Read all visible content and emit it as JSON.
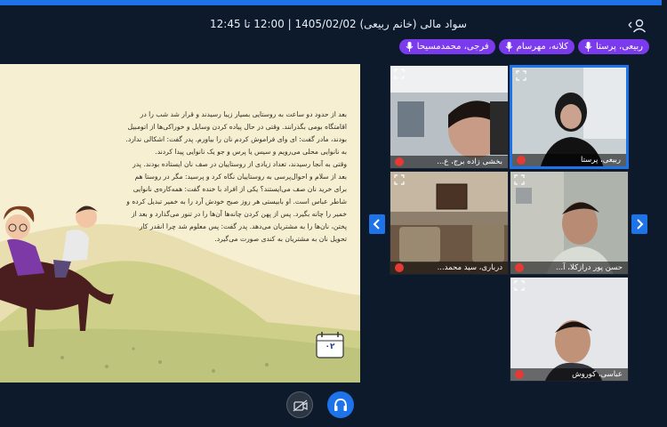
{
  "header": {
    "title": "سواد مالی (خانم ربیعی) 1405/02/02 | 12:00 تا 12:45"
  },
  "participants_bar": [
    {
      "name": "ربیعی، پرستا"
    },
    {
      "name": "کلانه، مهرسام"
    },
    {
      "name": "فرجی، محمدمسیحا"
    }
  ],
  "slide": {
    "paragraphs": [
      "بعد از حدود دو ساعت به روستایی بسیار زیبا رسیدند و قرار شد شب را در اقامتگاه بومی بگذرانند. وقتی در حال پیاده کردن وسایل و خوراکی‌ها از اتومبیل بودند، مادر گفت: ای وای فراموش کردم نان را بیاورم. پدر گفت: اشکالی ندارد. به نانوایی محلی می‌رویم و سیس یا پرس و جو یک نانوایی پیدا کردند.",
      "وقتی به آنجا رسیدند، تعداد زیادی از روستاییان در صف نان ایستاده بودند. پدر بعد از سلام و احوال‌پرسی به روستاییان نگاه کرد و پرسید: مگر در روستا هم برای خرید نان صف می‌ایستند؟ یکی از افراد با خنده گفت: همه‌کاره‌ی نانوایی شاطر عباس است. او بابیستی هر روز صبح خودش آرد را به خمیر تبدیل کرده و خمیر را چانه بگیرد. پس از پهن کردن چانه‌ها آن‌ها را در تنور می‌گذارد و بعد از پختن، نان‌ها را به مشتریان می‌دهد. پدر گفت: پس معلوم شد چرا انقدر کار تحویل نان به مشتریان به کندی صورت می‌گیرد."
    ],
    "calendar_number": "۰۲"
  },
  "videos": [
    {
      "name": "ربیعی، پرستا",
      "active": true
    },
    {
      "name": "بخشی زاده برج، ع...",
      "active": false
    },
    {
      "name": "حسن پور درازکلا، آ...",
      "active": false
    },
    {
      "name": "درباری، سید محمد...",
      "active": false
    },
    {
      "name": "عباسی، کوروش",
      "active": false
    }
  ],
  "colors": {
    "accent": "#1e73e8",
    "chip": "#7c3aed",
    "background": "#0c1a2c",
    "slide_bg": "#f6efd2",
    "mute": "#e53935"
  }
}
